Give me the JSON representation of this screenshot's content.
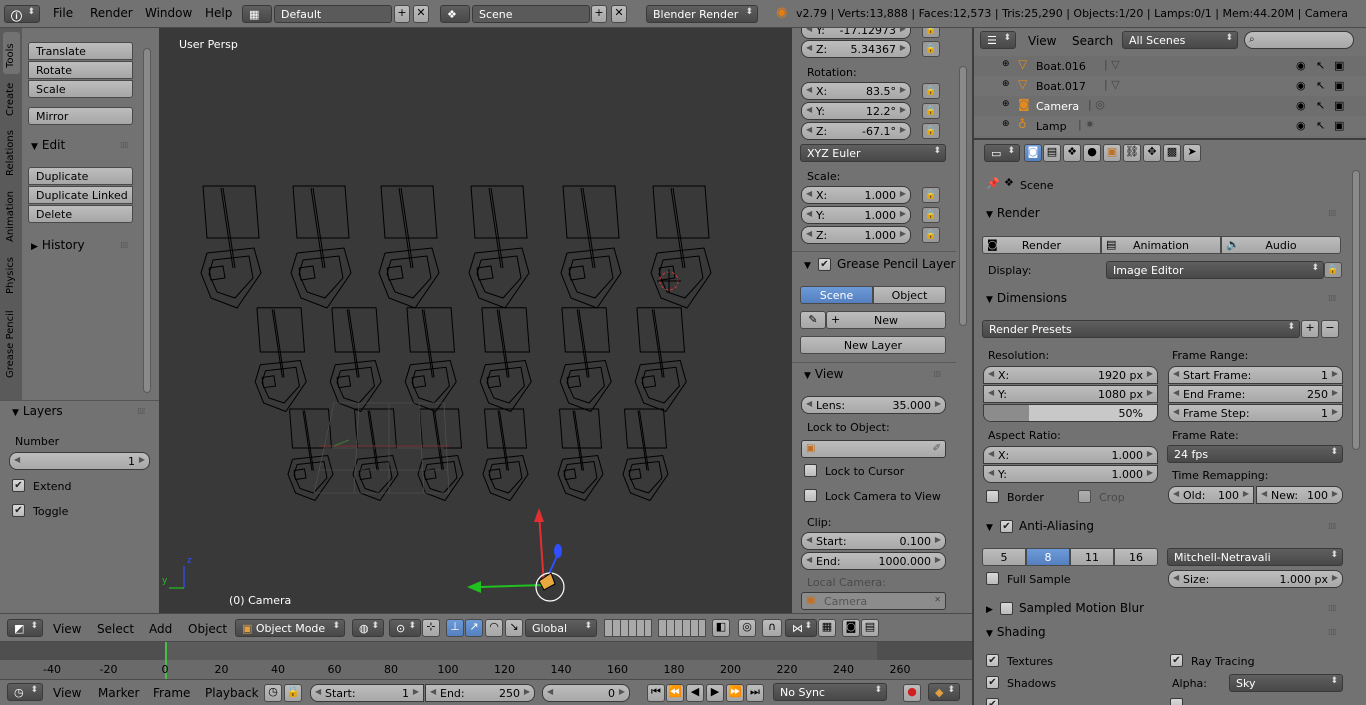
{
  "topbar": {
    "menus": [
      "File",
      "Render",
      "Window",
      "Help"
    ],
    "layout": "Default",
    "scene": "Scene",
    "engine": "Blender Render",
    "stats": "v2.79 | Verts:13,888 | Faces:12,573 | Tris:25,290 | Objects:1/20 | Lamps:0/1 | Mem:44.20M | Camera"
  },
  "tool_tabs": [
    "Tools",
    "Create",
    "Relations",
    "Animation",
    "Physics",
    "Grease Pencil"
  ],
  "toolshelf": {
    "transform_buttons": [
      "Translate",
      "Rotate",
      "Scale"
    ],
    "mirror": "Mirror",
    "edit_header": "Edit",
    "edit_buttons": [
      "Duplicate",
      "Duplicate Linked",
      "Delete"
    ],
    "history_header": "History"
  },
  "layers_panel": {
    "header": "Layers",
    "number_label": "Number",
    "number_value": "1",
    "extend": "Extend",
    "toggle": "Toggle"
  },
  "viewport": {
    "label": "User Persp",
    "object_label": "(0) Camera",
    "axis_z": "z",
    "axis_y": "y"
  },
  "properties": {
    "loc_y": {
      "label": "Y:",
      "value": "-17.12973"
    },
    "loc_z": {
      "label": "Z:",
      "value": "5.34367"
    },
    "rotation_label": "Rotation:",
    "rot": [
      {
        "label": "X:",
        "value": "83.5°"
      },
      {
        "label": "Y:",
        "value": "12.2°"
      },
      {
        "label": "Z:",
        "value": "-67.1°"
      }
    ],
    "rotation_mode": "XYZ Euler",
    "scale_label": "Scale:",
    "scale": [
      {
        "label": "X:",
        "value": "1.000"
      },
      {
        "label": "Y:",
        "value": "1.000"
      },
      {
        "label": "Z:",
        "value": "1.000"
      }
    ],
    "gp_header": "Grease Pencil Layers",
    "gp_scene": "Scene",
    "gp_object": "Object",
    "gp_new": "New",
    "gp_new_layer": "New Layer",
    "view_header": "View",
    "lens": {
      "label": "Lens:",
      "value": "35.000"
    },
    "lock_to_object": "Lock to Object:",
    "lock_to_cursor": "Lock to Cursor",
    "lock_camera_to_view": "Lock Camera to View",
    "clip_label": "Clip:",
    "clip_start": {
      "label": "Start:",
      "value": "0.100"
    },
    "clip_end": {
      "label": "End:",
      "value": "1000.000"
    },
    "local_camera_label": "Local Camera:",
    "local_camera": "Camera"
  },
  "outliner": {
    "menus": [
      "View",
      "Search"
    ],
    "filter": "All Scenes",
    "items": [
      "Boat.016",
      "Boat.017",
      "Camera",
      "Lamp"
    ]
  },
  "render_props": {
    "scene_label": "Scene",
    "render_header": "Render",
    "render_btn": "Render",
    "animation_btn": "Animation",
    "audio_btn": "Audio",
    "display_label": "Display:",
    "display_value": "Image Editor",
    "dimensions_header": "Dimensions",
    "presets": "Render Presets",
    "resolution_label": "Resolution:",
    "res_x": {
      "label": "X:",
      "value": "1920 px"
    },
    "res_y": {
      "label": "Y:",
      "value": "1080 px"
    },
    "res_pct": "50%",
    "res_pct_fill": 0.5,
    "frame_range_label": "Frame Range:",
    "start_frame": {
      "label": "Start Frame:",
      "value": "1"
    },
    "end_frame": {
      "label": "End Frame:",
      "value": "250"
    },
    "frame_step": {
      "label": "Frame Step:",
      "value": "1"
    },
    "aspect_label": "Aspect Ratio:",
    "aspect_x": {
      "label": "X:",
      "value": "1.000"
    },
    "aspect_y": {
      "label": "Y:",
      "value": "1.000"
    },
    "frame_rate_label": "Frame Rate:",
    "frame_rate": "24 fps",
    "time_remap_label": "Time Remapping:",
    "old": {
      "label": "Old:",
      "value": "100"
    },
    "new": {
      "label": "New:",
      "value": "100"
    },
    "border": "Border",
    "crop": "Crop",
    "aa_header": "Anti-Aliasing",
    "aa_samples": [
      "5",
      "8",
      "11",
      "16"
    ],
    "aa_filter": "Mitchell-Netravali",
    "full_sample": "Full Sample",
    "size": {
      "label": "Size:",
      "value": "1.000 px"
    },
    "motion_blur_header": "Sampled Motion Blur",
    "shading_header": "Shading",
    "textures": "Textures",
    "ray_tracing": "Ray Tracing",
    "shadows": "Shadows",
    "alpha_label": "Alpha:",
    "alpha_value": "Sky"
  },
  "view3d_header": {
    "menus": [
      "View",
      "Select",
      "Add",
      "Object"
    ],
    "mode": "Object Mode",
    "orientation": "Global"
  },
  "timeline": {
    "ticks": [
      "-40",
      "-20",
      "0",
      "20",
      "40",
      "60",
      "80",
      "100",
      "120",
      "140",
      "160",
      "180",
      "200",
      "220",
      "240",
      "260"
    ],
    "menus": [
      "View",
      "Marker",
      "Frame",
      "Playback"
    ],
    "start": {
      "label": "Start:",
      "value": "1"
    },
    "end": {
      "label": "End:",
      "value": "250"
    },
    "current": "0",
    "sync": "No Sync"
  }
}
